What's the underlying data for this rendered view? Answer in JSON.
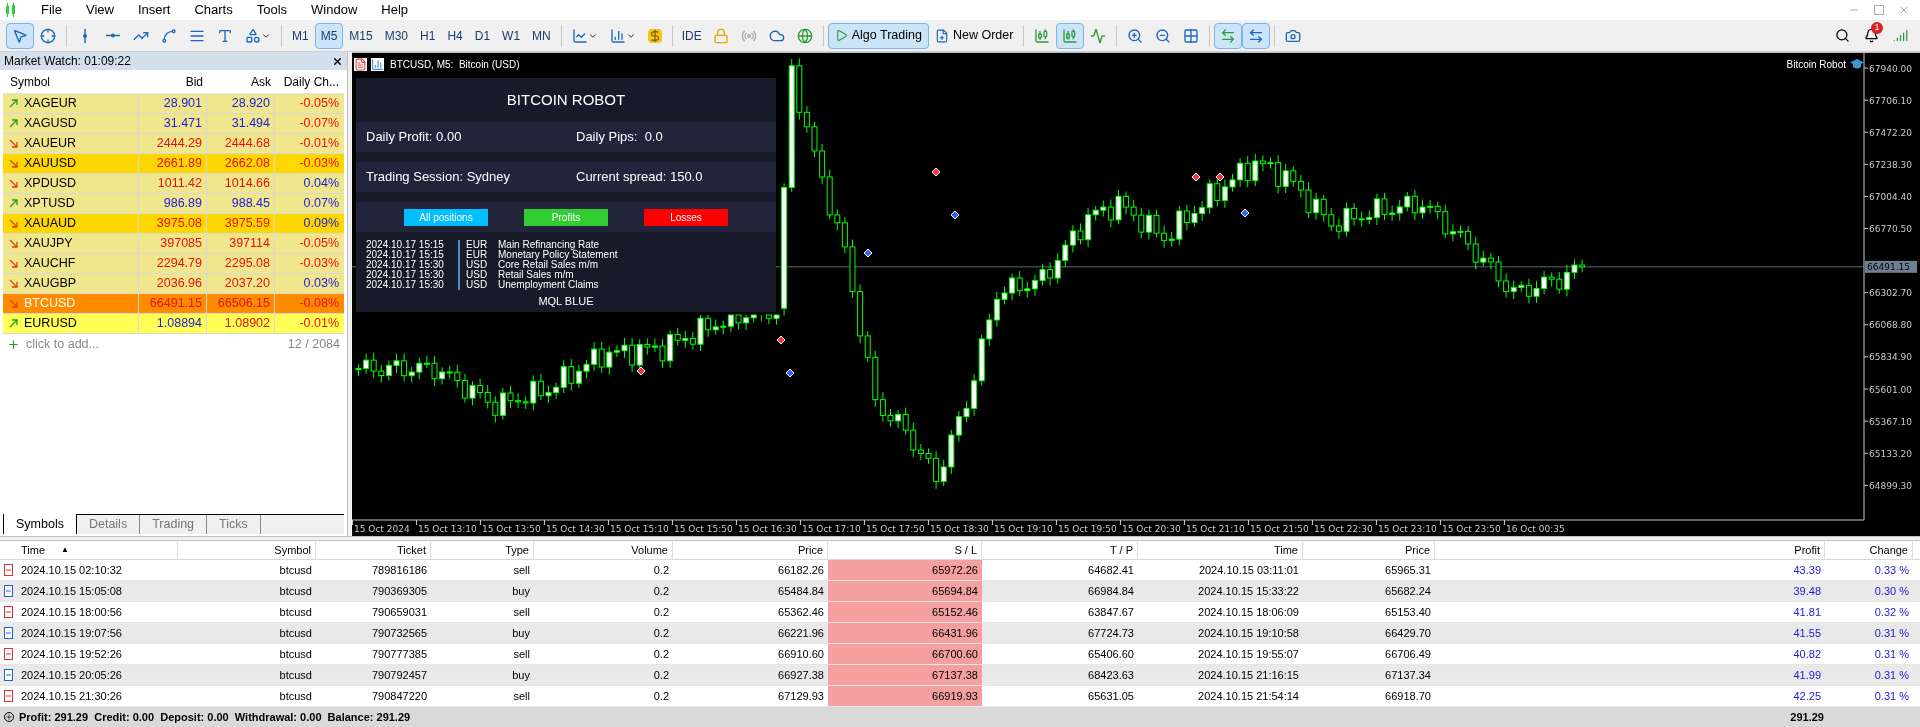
{
  "menu": [
    "File",
    "View",
    "Insert",
    "Charts",
    "Tools",
    "Window",
    "Help"
  ],
  "toolbar": {
    "timeframes": [
      {
        "label": "M1",
        "selected": false
      },
      {
        "label": "M5",
        "selected": true
      },
      {
        "label": "M15",
        "selected": false
      },
      {
        "label": "M30",
        "selected": false
      },
      {
        "label": "H1",
        "selected": false
      },
      {
        "label": "H4",
        "selected": false
      },
      {
        "label": "D1",
        "selected": false
      },
      {
        "label": "W1",
        "selected": false
      },
      {
        "label": "MN",
        "selected": false
      }
    ],
    "ide": "IDE",
    "algo_trading": {
      "label": "Algo Trading",
      "on": true
    },
    "new_order": "New Order",
    "notification_count": "1"
  },
  "market_watch": {
    "title": "Market Watch: 01:09:22",
    "columns": [
      "Symbol",
      "Bid",
      "Ask",
      "Daily Ch..."
    ],
    "rows": [
      {
        "symbol": "XAGEUR",
        "rising": true,
        "bid": "28.901",
        "bid_up": true,
        "ask": "28.920",
        "ask_up": true,
        "change": "-0.05%",
        "change_up": false,
        "color": "#f0e68c",
        "selected": false
      },
      {
        "symbol": "XAGUSD",
        "rising": true,
        "bid": "31.471",
        "bid_up": true,
        "ask": "31.494",
        "ask_up": true,
        "change": "-0.07%",
        "change_up": false,
        "color": "#f0e68c",
        "selected": false
      },
      {
        "symbol": "XAUEUR",
        "rising": false,
        "bid": "2444.29",
        "bid_up": false,
        "ask": "2444.68",
        "ask_up": false,
        "change": "-0.01%",
        "change_up": false,
        "color": "#f0e68c",
        "selected": false
      },
      {
        "symbol": "XAUUSD",
        "rising": false,
        "bid": "2661.89",
        "bid_up": false,
        "ask": "2662.08",
        "ask_up": false,
        "change": "-0.03%",
        "change_up": false,
        "color": "#ffd700",
        "selected": false
      },
      {
        "symbol": "XPDUSD",
        "rising": false,
        "bid": "1011.42",
        "bid_up": false,
        "ask": "1014.66",
        "ask_up": false,
        "change": "0.04%",
        "change_up": true,
        "color": "#f0e68c",
        "selected": false
      },
      {
        "symbol": "XPTUSD",
        "rising": true,
        "bid": "986.89",
        "bid_up": true,
        "ask": "988.45",
        "ask_up": true,
        "change": "0.07%",
        "change_up": true,
        "color": "#f0e68c",
        "selected": false
      },
      {
        "symbol": "XAUAUD",
        "rising": false,
        "bid": "3975.08",
        "bid_up": false,
        "ask": "3975.59",
        "ask_up": false,
        "change": "0.09%",
        "change_up": true,
        "color": "#ffd700",
        "selected": false
      },
      {
        "symbol": "XAUJPY",
        "rising": false,
        "bid": "397085",
        "bid_up": false,
        "ask": "397114",
        "ask_up": false,
        "change": "-0.05%",
        "change_up": false,
        "color": "#f0e68c",
        "selected": false
      },
      {
        "symbol": "XAUCHF",
        "rising": false,
        "bid": "2294.79",
        "bid_up": false,
        "ask": "2295.08",
        "ask_up": false,
        "change": "-0.03%",
        "change_up": false,
        "color": "#f0e68c",
        "selected": false
      },
      {
        "symbol": "XAUGBP",
        "rising": false,
        "bid": "2036.96",
        "bid_up": false,
        "ask": "2037.20",
        "ask_up": false,
        "change": "0.03%",
        "change_up": true,
        "color": "#f0e68c",
        "selected": false
      },
      {
        "symbol": "BTCUSD",
        "rising": false,
        "bid": "66491.15",
        "bid_up": false,
        "ask": "66506.15",
        "ask_up": false,
        "change": "-0.08%",
        "change_up": false,
        "color": "#ff8c00",
        "selected": true
      },
      {
        "symbol": "EURUSD",
        "rising": true,
        "bid": "1.08894",
        "bid_up": true,
        "ask": "1.08902",
        "ask_up": false,
        "change": "-0.01%",
        "change_up": false,
        "color": "#ffff55",
        "selected": false
      }
    ],
    "add_placeholder": "click to add...",
    "count": "12 / 2084",
    "tabs": [
      {
        "label": "Symbols",
        "selected": true
      },
      {
        "label": "Details",
        "selected": false
      },
      {
        "label": "Trading",
        "selected": false
      },
      {
        "label": "Ticks",
        "selected": false
      }
    ]
  },
  "chart": {
    "title": "BTCUSD, M5:  Bitcoin (USD)",
    "expert": "Bitcoin Robot",
    "price_axis": [
      "67940.00",
      "67706.10",
      "67472.20",
      "67238.30",
      "67004.40",
      "66770.50",
      "66302.70",
      "66068.80",
      "65834.90",
      "65601.00",
      "65367.10",
      "65133.20",
      "64899.30"
    ],
    "current_price": "66491.15",
    "time_axis": [
      "15 Oct 2024",
      "15 Oct 13:10",
      "15 Oct 13:50",
      "15 Oct 14:30",
      "15 Oct 15:10",
      "15 Oct 15:50",
      "15 Oct 16:30",
      "15 Oct 17:10",
      "15 Oct 17:50",
      "15 Oct 18:30",
      "15 Oct 19:10",
      "15 Oct 19:50",
      "15 Oct 20:30",
      "15 Oct 21:10",
      "15 Oct 21:50",
      "15 Oct 22:30",
      "15 Oct 23:10",
      "15 Oct 23:50",
      "16 Oct 00:35"
    ],
    "panel": {
      "title": "BITCOIN ROBOT",
      "daily_profit": "Daily Profit: 0.00",
      "daily_pips": "Daily Pips:  0.0",
      "session": "Trading Session: Sydney",
      "spread": "Current spread: 150.0",
      "buttons": [
        {
          "label": "All positions",
          "color": "#00bfff"
        },
        {
          "label": "Profits",
          "color": "#32cd32"
        },
        {
          "label": "Losses",
          "color": "#ff0000"
        }
      ],
      "news": [
        {
          "time": "2024.10.17 15:15",
          "currency": "EUR",
          "event": "Main Refinancing Rate"
        },
        {
          "time": "2024.10.17 15:15",
          "currency": "EUR",
          "event": "Monetary Policy Statement"
        },
        {
          "time": "2024.10.17 15:30",
          "currency": "USD",
          "event": "Core Retail Sales m/m"
        },
        {
          "time": "2024.10.17 15:30",
          "currency": "USD",
          "event": "Retail Sales m/m"
        },
        {
          "time": "2024.10.17 15:30",
          "currency": "USD",
          "event": "Unemployment Claims"
        }
      ],
      "footer": "MQL BLUE"
    }
  },
  "trades": {
    "columns": [
      "Time",
      "Symbol",
      "Ticket",
      "Type",
      "Volume",
      "Price",
      "S / L",
      "T / P",
      "Time",
      "Price",
      "Profit",
      "Change"
    ],
    "sort_indicator": "▲",
    "rows": [
      {
        "kind": "sell",
        "time": "2024.10.15 02:10:32",
        "symbol": "btcusd",
        "ticket": "789816186",
        "type": "sell",
        "volume": "0.2",
        "price": "66182.26",
        "sl": "65972.26",
        "tp": "64682.41",
        "close_time": "2024.10.15 03:11:01",
        "close_price": "65965.31",
        "profit": "43.39",
        "change": "0.33 %"
      },
      {
        "kind": "buy",
        "time": "2024.10.15 15:05:08",
        "symbol": "btcusd",
        "ticket": "790369305",
        "type": "buy",
        "volume": "0.2",
        "price": "65484.84",
        "sl": "65694.84",
        "tp": "66984.84",
        "close_time": "2024.10.15 15:33:22",
        "close_price": "65682.24",
        "profit": "39.48",
        "change": "0.30 %"
      },
      {
        "kind": "sell",
        "time": "2024.10.15 18:00:56",
        "symbol": "btcusd",
        "ticket": "790659031",
        "type": "sell",
        "volume": "0.2",
        "price": "65362.46",
        "sl": "65152.46",
        "tp": "63847.67",
        "close_time": "2024.10.15 18:06:09",
        "close_price": "65153.40",
        "profit": "41.81",
        "change": "0.32 %"
      },
      {
        "kind": "buy",
        "time": "2024.10.15 19:07:56",
        "symbol": "btcusd",
        "ticket": "790732565",
        "type": "buy",
        "volume": "0.2",
        "price": "66221.96",
        "sl": "66431.96",
        "tp": "67724.73",
        "close_time": "2024.10.15 19:10:58",
        "close_price": "66429.70",
        "profit": "41.55",
        "change": "0.31 %"
      },
      {
        "kind": "sell",
        "time": "2024.10.15 19:52:26",
        "symbol": "btcusd",
        "ticket": "790777385",
        "type": "sell",
        "volume": "0.2",
        "price": "66910.60",
        "sl": "66700.60",
        "tp": "65406.60",
        "close_time": "2024.10.15 19:55:07",
        "close_price": "66706.49",
        "profit": "40.82",
        "change": "0.31 %"
      },
      {
        "kind": "buy",
        "time": "2024.10.15 20:05:26",
        "symbol": "btcusd",
        "ticket": "790792457",
        "type": "buy",
        "volume": "0.2",
        "price": "66927.38",
        "sl": "67137.38",
        "tp": "68423.63",
        "close_time": "2024.10.15 21:16:15",
        "close_price": "67137.34",
        "profit": "41.99",
        "change": "0.31 %"
      },
      {
        "kind": "sell",
        "time": "2024.10.15 21:30:26",
        "symbol": "btcusd",
        "ticket": "790847220",
        "type": "sell",
        "volume": "0.2",
        "price": "67129.93",
        "sl": "66919.93",
        "tp": "65631.05",
        "close_time": "2024.10.15 21:54:14",
        "close_price": "66918.70",
        "profit": "42.25",
        "change": "0.31 %"
      }
    ],
    "summary": "Profit: 291.29  Credit: 0.00  Deposit: 0.00  Withdrawal: 0.00  Balance: 291.29",
    "total_profit": "291.29"
  }
}
